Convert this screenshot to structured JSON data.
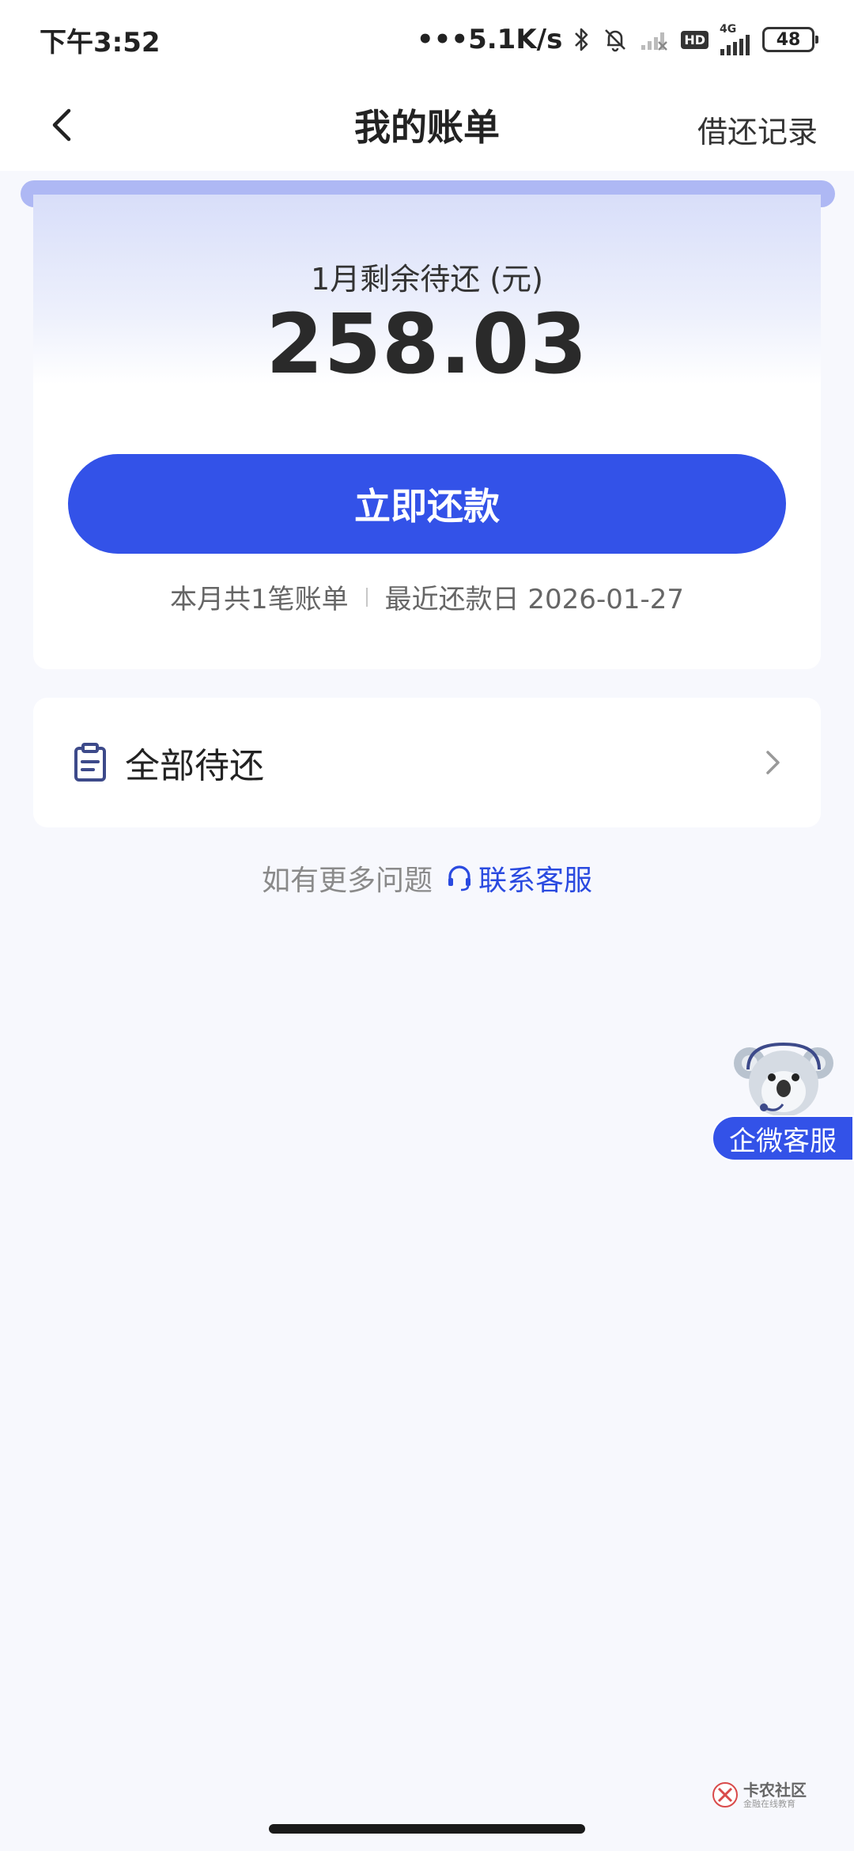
{
  "status_bar": {
    "time": "下午3:52",
    "network_speed": "•••5.1K/s",
    "hd_label": "HD",
    "signal_label": "4G",
    "battery": "48",
    "icons": [
      "bluetooth-icon",
      "mute-bell-icon",
      "wifi-off-icon",
      "hd-icon",
      "cell-signal-icon",
      "battery-icon"
    ]
  },
  "nav": {
    "title": "我的账单",
    "right_link": "借还记录"
  },
  "bill": {
    "label": "1月剩余待还 (元)",
    "amount": "258.03",
    "repay_button": "立即还款",
    "count_text": "本月共1笔账单",
    "due_text": "最近还款日 2026-01-27"
  },
  "pending": {
    "label": "全部待还"
  },
  "help": {
    "prefix": "如有更多问题",
    "link": "联系客服"
  },
  "float_service": {
    "label": "企微客服"
  },
  "watermark": {
    "title": "卡农社区",
    "subtitle": "金融在线教育"
  },
  "colors": {
    "primary": "#3352e8",
    "link": "#2a4ae0",
    "page_bg": "#f7f8fd",
    "accent_strip": "#aeb8f4",
    "card_gradient_top": "#d8def9"
  }
}
